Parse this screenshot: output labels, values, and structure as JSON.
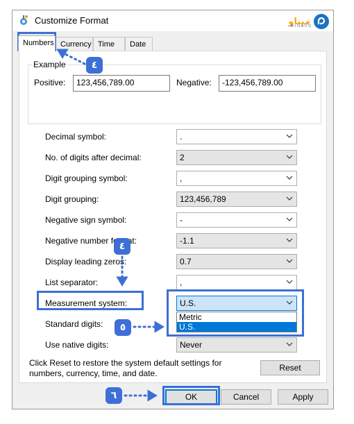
{
  "window": {
    "title": "Customize Format",
    "logo": {
      "text": "میناو",
      "subtext": "MINAVO"
    }
  },
  "tabs": [
    {
      "label": "Numbers",
      "active": true
    },
    {
      "label": "Currency",
      "active": false
    },
    {
      "label": "Time",
      "active": false
    },
    {
      "label": "Date",
      "active": false
    }
  ],
  "example": {
    "legend": "Example",
    "positive_label": "Positive:",
    "positive_value": "123,456,789.00",
    "negative_label": "Negative:",
    "negative_value": "-123,456,789.00"
  },
  "settings": [
    {
      "label": "Decimal symbol:",
      "value": ".",
      "editable": true
    },
    {
      "label": "No. of digits after decimal:",
      "value": "2",
      "editable": false
    },
    {
      "label": "Digit grouping symbol:",
      "value": ",",
      "editable": true
    },
    {
      "label": "Digit grouping:",
      "value": "123,456,789",
      "editable": false
    },
    {
      "label": "Negative sign symbol:",
      "value": "-",
      "editable": true
    },
    {
      "label": "Negative number format:",
      "value": "-1.1",
      "editable": false
    },
    {
      "label": "Display leading zeros:",
      "value": "0.7",
      "editable": false
    },
    {
      "label": "List separator:",
      "value": ",",
      "editable": true
    },
    {
      "label": "Measurement system:",
      "value": "U.S.",
      "editable": false
    },
    {
      "label": "Standard digits:",
      "value": "",
      "editable": false
    },
    {
      "label": "Use native digits:",
      "value": "Never",
      "editable": false
    }
  ],
  "measurement_dropdown": {
    "options": [
      "Metric",
      "U.S."
    ],
    "selected": "U.S."
  },
  "reset_note": "Click Reset to restore the system default settings for numbers, currency, time, and date.",
  "buttons": {
    "reset": "Reset",
    "ok": "OK",
    "cancel": "Cancel",
    "apply": "Apply"
  },
  "annotations": {
    "step_4": "٤",
    "step_5": "٥",
    "step_6": "٦"
  },
  "colors": {
    "highlight": "#3d6fd6",
    "selection": "#0078d7",
    "logo_orange": "#f3a31b"
  }
}
